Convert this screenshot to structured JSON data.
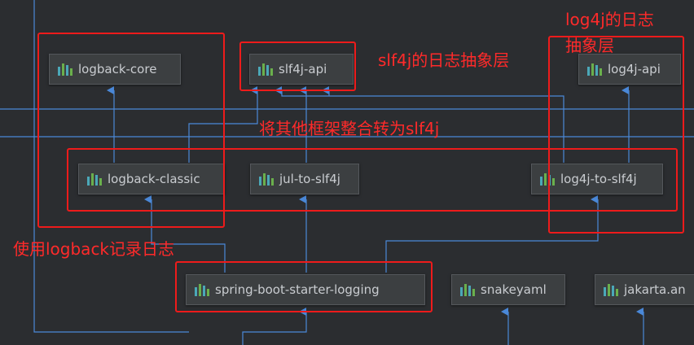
{
  "nodes": {
    "logback_core": "logback-core",
    "slf4j_api": "slf4j-api",
    "log4j_api": "log4j-api",
    "logback_classic": "logback-classic",
    "jul_to_slf4j": "jul-to-slf4j",
    "log4j_to_slf4j": "log4j-to-slf4j",
    "spring_boot_starter_logging": "spring-boot-starter-logging",
    "snakeyaml": "snakeyaml",
    "jakarta_an": "jakarta.an"
  },
  "annotations": {
    "log4j_top_line1": "log4j的日志",
    "log4j_top_line2": "抽象层",
    "slf4j_abstraction": "slf4j的日志抽象层",
    "bridge_to_slf4j": "将其他框架整合转为slf4j",
    "use_logback": "使用logback记录日志"
  },
  "colors": {
    "background": "#2b2d30",
    "edge": "#4a88d8",
    "annotation": "#ff2a2a",
    "node_fill": "#3c3f41"
  }
}
